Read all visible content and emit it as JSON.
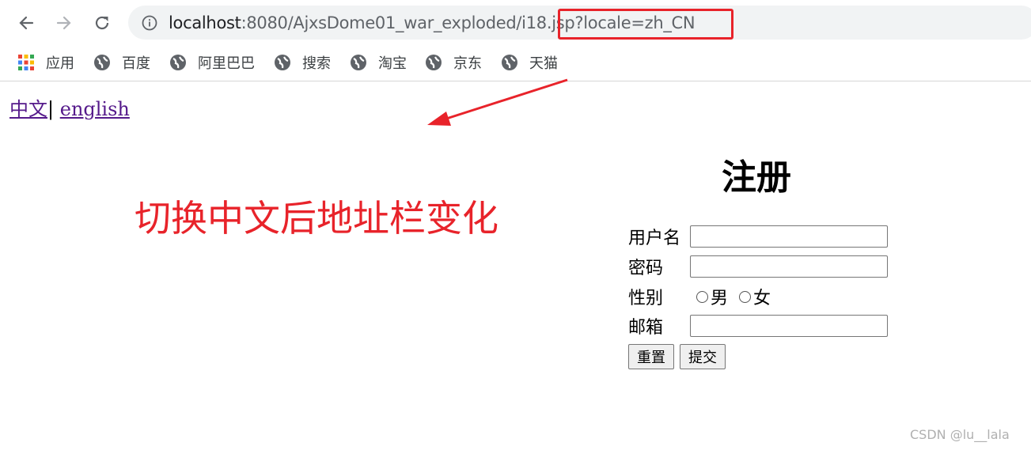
{
  "browser": {
    "url_host": "localhost",
    "url_rest": ":8080/AjxsDome01_war_exploded/i18.jsp",
    "url_query": "?locale=zh_CN",
    "bookmarks": [
      {
        "label": "应用",
        "icon": "apps-grid-icon"
      },
      {
        "label": "百度",
        "icon": "globe-icon"
      },
      {
        "label": "阿里巴巴",
        "icon": "globe-icon"
      },
      {
        "label": "搜索",
        "icon": "globe-icon"
      },
      {
        "label": "淘宝",
        "icon": "globe-icon"
      },
      {
        "label": "京东",
        "icon": "globe-icon"
      },
      {
        "label": "天猫",
        "icon": "globe-icon"
      }
    ]
  },
  "page": {
    "lang_zh": "中文",
    "lang_sep": "|",
    "lang_en": "english",
    "annotation": "切换中文后地址栏变化",
    "form": {
      "title": "注册",
      "username_label": "用户名",
      "password_label": "密码",
      "gender_label": "性别",
      "gender_male": "男",
      "gender_female": "女",
      "email_label": "邮箱",
      "reset_label": "重置",
      "submit_label": "提交"
    },
    "watermark": "CSDN @lu__lala"
  },
  "colors": {
    "annotation_red": "#e8232a",
    "visited_link": "#551a8b"
  }
}
